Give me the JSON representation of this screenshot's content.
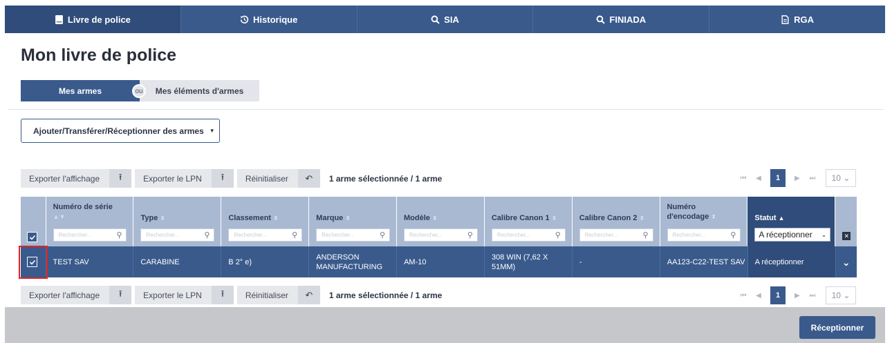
{
  "nav": {
    "tabs": [
      {
        "label": "Livre de police",
        "icon": "book-icon"
      },
      {
        "label": "Historique",
        "icon": "history-icon"
      },
      {
        "label": "SIA",
        "icon": "search-icon"
      },
      {
        "label": "FINIADA",
        "icon": "search-icon"
      },
      {
        "label": "RGA",
        "icon": "document-icon"
      }
    ]
  },
  "page": {
    "title": "Mon livre de police"
  },
  "toggle": {
    "left": "Mes armes",
    "or": "ou",
    "right": "Mes éléments d'armes"
  },
  "actions": {
    "dropdown_label": "Ajouter/Transférer/Réceptionner des armes"
  },
  "toolbar": {
    "export_display": "Exporter l'affichage",
    "export_lpn": "Exporter le LPN",
    "reset": "Réinitialiser",
    "selection": "1 arme sélectionnée / 1 arme"
  },
  "pager": {
    "first": "⏮",
    "prev": "◀",
    "current": "1",
    "next": "▶",
    "last": "⏭",
    "per_page": "10"
  },
  "table": {
    "headers": {
      "serial": "Numéro de série",
      "type": "Type",
      "class": "Classement",
      "brand": "Marque",
      "model": "Modèle",
      "caliber1": "Calibre Canon 1",
      "caliber2": "Calibre Canon 2",
      "encoding_line1": "Numéro",
      "encoding_line2": "d'encodage",
      "status": "Statut"
    },
    "filter_placeholder": "Rechercher...",
    "status_filter_value": "A réceptionner",
    "rows": [
      {
        "serial": "TEST SAV",
        "type": "CARABINE",
        "class": "B 2° e)",
        "brand": "ANDERSON MANUFACTURING",
        "model": "AM-10",
        "caliber1": "308 WIN (7,62 X 51MM)",
        "caliber2": "-",
        "encoding": "AA123-C22-TEST SAV",
        "status": "A réceptionner"
      }
    ]
  },
  "footer": {
    "receive_button": "Réceptionner"
  },
  "colors": {
    "primary": "#3a5a8c",
    "header": "#a9b9d2",
    "highlight": "#e12222"
  }
}
